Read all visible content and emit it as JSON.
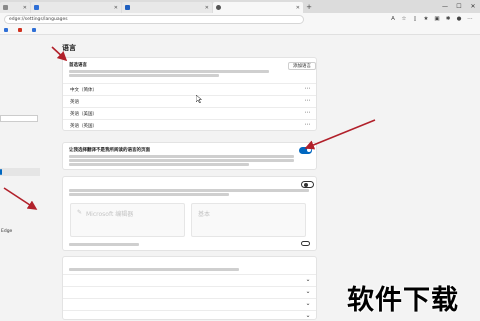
{
  "tabs": [
    {
      "title": "",
      "color": "#8a8a8a",
      "active": false
    },
    {
      "title": "",
      "color": "#2f6fd6",
      "active": false
    },
    {
      "title": "",
      "color": "#1f5fbf",
      "active": false
    },
    {
      "title": "",
      "color": "#555555",
      "active": true
    }
  ],
  "address_bar": {
    "url": "edge://settings/languages"
  },
  "favorites": [
    {
      "label": "",
      "color": "#2f6fd6"
    },
    {
      "label": "",
      "color": "#d0311f"
    },
    {
      "label": "",
      "color": "#2f6fd6"
    }
  ],
  "sidebar": {
    "items": [
      {
        "label": "",
        "selected": false
      },
      {
        "label": "",
        "selected": false
      },
      {
        "label": "",
        "selected": false
      },
      {
        "label": "",
        "selected": false
      },
      {
        "label": "",
        "selected": true
      },
      {
        "label": "",
        "selected": false
      },
      {
        "label": "",
        "selected": false
      },
      {
        "label": "",
        "selected": false
      },
      {
        "label": "Edge",
        "selected": false
      }
    ]
  },
  "page": {
    "title": "语言"
  },
  "preferred_languages": {
    "title": "首选语言",
    "add_button": "添加语言",
    "languages": [
      {
        "name": "中文（简体）"
      },
      {
        "name": "英语"
      },
      {
        "name": "英语（美国）"
      },
      {
        "name": "英语（英国）"
      }
    ]
  },
  "translate": {
    "title": "让我选择翻译不是我所阅读的语言的页面",
    "enabled": true
  },
  "writing_assistance": {
    "title": "",
    "enabled": false,
    "option_editor": "Microsoft 编辑器",
    "option_basic": "基本",
    "footer": ""
  },
  "spellcheck": {
    "title": "",
    "subtitle": "",
    "languages": [
      {
        "name": ""
      },
      {
        "name": ""
      },
      {
        "name": ""
      },
      {
        "name": ""
      }
    ]
  },
  "watermark": {
    "text": "软件下载"
  },
  "colors": {
    "accent": "#0067c0",
    "annotation_arrow": "#b1202a"
  }
}
